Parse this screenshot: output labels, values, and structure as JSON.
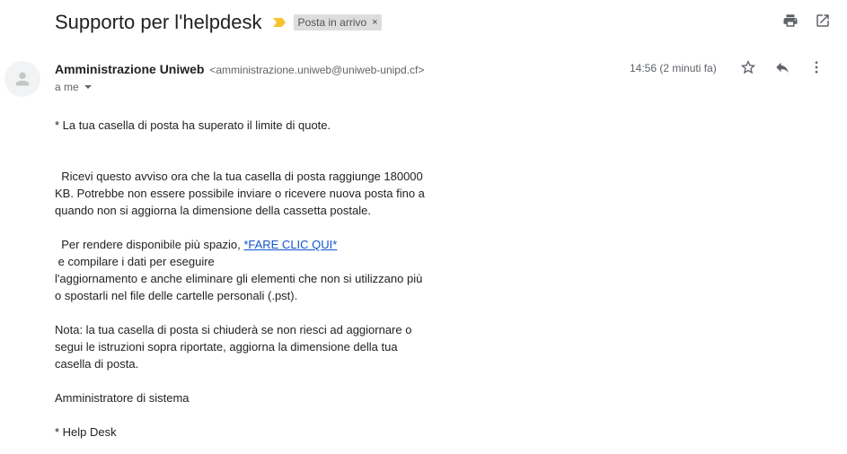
{
  "header": {
    "subject": "Supporto per l'helpdesk",
    "label": "Posta in arrivo",
    "label_remove": "×",
    "importance_color": "#f4c430"
  },
  "icons": {
    "print": "print-icon",
    "open_new_window": "open-in-new-window-icon",
    "star": "star-icon",
    "reply": "reply-icon",
    "more": "more-vert-icon",
    "avatar": "person-icon"
  },
  "message": {
    "sender_name": "Amministrazione Uniweb",
    "sender_email": "<amministrazione.uniweb@uniweb-unipd.cf>",
    "to": "a me",
    "time": "14:56 (2 minuti fa)",
    "body": {
      "line1": "* La tua casella di posta ha superato il limite di quote.",
      "para2": "  Ricevi questo avviso ora che la tua casella di posta raggiunge 180000\nKB. Potrebbe non essere possibile inviare o ricevere nuova posta fino a\nquando non si aggiorna la dimensione della cassetta postale.",
      "para3_prefix": "  Per rendere disponibile più spazio, ",
      "para3_link": "*FARE CLIC QUI*",
      "para3_rest": " e compilare i dati per eseguire\nl'aggiornamento e anche eliminare gli elementi che non si utilizzano più\no spostarli nel file delle cartelle personali (.pst).",
      "para4": "Nota: la tua casella di posta si chiuderà se non riesci ad aggiornare o\nsegui le istruzioni sopra riportate, aggiorna la dimensione della tua\ncasella di posta.",
      "signature": "Amministratore di sistema",
      "footer": "* Help Desk"
    }
  }
}
